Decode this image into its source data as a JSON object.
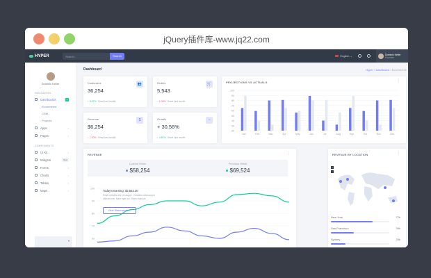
{
  "window": {
    "title": "jQuery插件库-www.jq22.com"
  },
  "topbar": {
    "logo": "HYPER",
    "search_placeholder": "Search...",
    "search_button": "Search",
    "language": "English",
    "user_name": "Dominic Keller",
    "user_role": "Founder"
  },
  "sidebar": {
    "user_name": "Dominic Keller",
    "nav_title": "NAVIGATION",
    "components_title": "COMPONENTS",
    "nav": [
      {
        "label": "Dashboards",
        "badge": "4"
      },
      {
        "label": "Apps"
      },
      {
        "label": "Pages"
      }
    ],
    "dash_sub": [
      "Ecommerce",
      "CRM",
      "Projects"
    ],
    "components": [
      {
        "label": "UI Kit"
      },
      {
        "label": "Widgets",
        "badge": "New"
      },
      {
        "label": "Forms"
      },
      {
        "label": "Charts"
      },
      {
        "label": "Tables"
      },
      {
        "label": "Maps"
      }
    ]
  },
  "main": {
    "title": "Dashboard",
    "breadcrumb": [
      "Hyper",
      "Dashboard",
      "Ecommerce"
    ]
  },
  "stats": [
    {
      "label": "Customers",
      "value": "36,254",
      "change": "5.27%",
      "dir": "up",
      "since": "Since last month",
      "icon": "users-icon",
      "glyph": "👥"
    },
    {
      "label": "Orders",
      "value": "5,543",
      "change": "1.08%",
      "dir": "down",
      "since": "Since last month",
      "icon": "cart-icon",
      "glyph": "🛒"
    },
    {
      "label": "Revenue",
      "value": "$6,254",
      "change": "7.00%",
      "dir": "down",
      "since": "Since last month",
      "icon": "dollar-icon",
      "glyph": "$"
    },
    {
      "label": "Growth",
      "value": "+ 30.56%",
      "change": "4.87%",
      "dir": "up",
      "since": "Since last month",
      "icon": "pulse-icon",
      "glyph": "~"
    }
  ],
  "colors": {
    "primary": "#727cf5",
    "secondary": "#e3eaef",
    "success": "#0acf97",
    "danger": "#fa5c7c",
    "topbar": "#313a46"
  },
  "chart_data": [
    {
      "type": "bar",
      "title": "PROJECTIONS VS ACTUALS",
      "categories": [
        "Jan",
        "Feb",
        "Mar",
        "Apr",
        "May",
        "Jun",
        "Jul",
        "Aug",
        "Sep",
        "Oct",
        "Nov",
        "Dec"
      ],
      "series": [
        {
          "values": [
            65,
            59,
            80,
            81,
            56,
            89,
            40,
            32,
            65,
            59,
            80,
            81
          ],
          "color": "#727cf5"
        },
        {
          "values": [
            89,
            40,
            32,
            65,
            59,
            80,
            81,
            56,
            89,
            40,
            32,
            65
          ],
          "color": "#e3eaef"
        }
      ],
      "ylim": [
        20,
        100
      ],
      "yticks": [
        20,
        30,
        40,
        50,
        60,
        70,
        80,
        90,
        100
      ],
      "grid": true
    },
    {
      "type": "line",
      "title": "REVENUE",
      "current_week": {
        "label": "Current Week",
        "value": "$58,254",
        "color": "#727cf5"
      },
      "previous_week": {
        "label": "Previous Week",
        "value": "$69,524",
        "color": "#0acf97"
      },
      "earnings": {
        "title": "Today's Earning: $2,562.30",
        "text": "Etiam ultricies nisi vel augue. Curabitur ullamcorper ultricies nisi. Nam eget dui. Etiam rhoncus.",
        "button": "View Statements"
      },
      "yticks": [
        60,
        70,
        80,
        90,
        100
      ],
      "ylim": [
        55,
        105
      ],
      "x": [
        0,
        1,
        2,
        3,
        4,
        5,
        6,
        7,
        8,
        9,
        10,
        11
      ],
      "series": [
        {
          "values": [
            57,
            58,
            62,
            65,
            69,
            66,
            62,
            60,
            65,
            68,
            64,
            59
          ],
          "color": "#727cf5"
        },
        {
          "values": [
            72,
            78,
            83,
            87,
            90,
            90,
            86,
            89,
            95,
            96,
            94,
            89
          ],
          "color": "#0acf97"
        }
      ]
    }
  ],
  "locations": {
    "title": "REVENUE BY LOCATION",
    "items": [
      {
        "name": "New York",
        "pct": "72k",
        "fill": 0.72
      },
      {
        "name": "San Francisco",
        "pct": "39k",
        "fill": 0.39
      },
      {
        "name": "Sydney",
        "pct": "25k",
        "fill": 0.25
      }
    ]
  }
}
